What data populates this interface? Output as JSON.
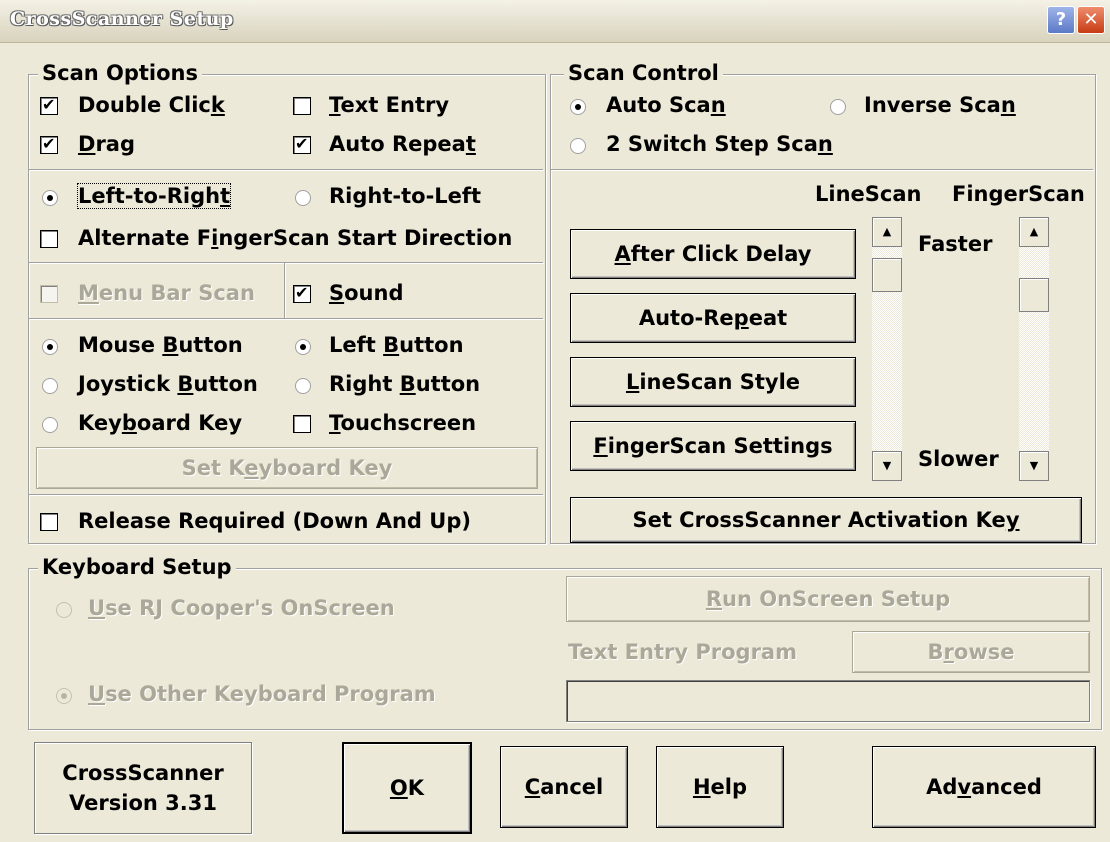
{
  "window": {
    "title": "CrossScanner Setup",
    "help_glyph": "?",
    "close_glyph": "✕"
  },
  "scan_options": {
    "title": "Scan Options",
    "double_click": {
      "pre": "Double Clic",
      "u": "k",
      "post": "",
      "checked": true
    },
    "text_entry": {
      "pre": "",
      "u": "T",
      "post": "ext Entry",
      "checked": false
    },
    "drag": {
      "pre": "",
      "u": "D",
      "post": "rag",
      "checked": true
    },
    "auto_repeat": {
      "pre": "Auto Repea",
      "u": "t",
      "post": "",
      "checked": true
    },
    "left_to_right": {
      "pre": "Left-to-Righ",
      "u": "t",
      "post": "",
      "selected": true
    },
    "right_to_left": {
      "label": "Right-to-Left",
      "selected": false
    },
    "alternate": {
      "pre": "Alternate F",
      "u": "i",
      "post": "ngerScan Start Direction",
      "checked": false
    },
    "menu_bar_scan": {
      "pre": "",
      "u": "M",
      "post": "enu Bar Scan",
      "checked": false,
      "enabled": false
    },
    "sound": {
      "pre": "",
      "u": "S",
      "post": "ound",
      "checked": true
    },
    "mouse_button": {
      "pre": "Mouse ",
      "u": "B",
      "post": "utton",
      "selected": true
    },
    "left_button": {
      "pre": "Left ",
      "u": "B",
      "post": "utton",
      "selected": true
    },
    "joystick_button": {
      "pre": "Joystick ",
      "u": "B",
      "post": "utton",
      "selected": false
    },
    "right_button": {
      "pre": "Right ",
      "u": "B",
      "post": "utton",
      "selected": false
    },
    "keyboard_key": {
      "pre": "Key",
      "u": "b",
      "post": "oard Key",
      "selected": false
    },
    "touchscreen": {
      "pre": "",
      "u": "T",
      "post": "ouchscreen",
      "checked": false
    },
    "set_keyboard_key": {
      "pre": "Set K",
      "u": "e",
      "post": "yboard Key"
    },
    "release_required": {
      "label": "Release Required (Down And Up)",
      "checked": false
    }
  },
  "scan_control": {
    "title": "Scan Control",
    "auto_scan": {
      "pre": "Auto Sca",
      "u": "n",
      "post": "",
      "selected": true
    },
    "inverse_scan": {
      "pre": "Inverse Sca",
      "u": "n",
      "post": "",
      "selected": false
    },
    "switch_step": {
      "pre": "2 Switch Step Sca",
      "u": "n",
      "post": "",
      "selected": false
    },
    "linescan_header": "LineScan",
    "fingerscan_header": "FingerScan",
    "faster": "Faster",
    "slower": "Slower",
    "after_click_delay": {
      "pre": "",
      "u": "A",
      "post": "fter Click Delay"
    },
    "auto_repeat_btn": {
      "pre": "Auto-Re",
      "u": "p",
      "post": "eat"
    },
    "linescan_style": {
      "pre": "",
      "u": "L",
      "post": "ineScan Style"
    },
    "fingerscan_settings": {
      "pre": "",
      "u": "F",
      "post": "ingerScan Settings"
    },
    "activation_key": {
      "pre": "Set CrossScanner Activation Ke",
      "u": "y",
      "post": ""
    }
  },
  "keyboard_setup": {
    "title": "Keyboard Setup",
    "use_rj": {
      "pre": "",
      "u": "U",
      "post": "se RJ Cooper's OnScreen",
      "selected": false
    },
    "use_other": {
      "pre": "",
      "u": "U",
      "post": "se Other Keyboard Program",
      "selected": true
    },
    "run_onscreen": {
      "pre": "",
      "u": "R",
      "post": "un OnScreen Setup"
    },
    "text_entry_program_label": "Text Entry Program",
    "browse": {
      "pre": "B",
      "u": "r",
      "post": "owse"
    },
    "program_path": ""
  },
  "footer": {
    "version_line1": "CrossScanner",
    "version_line2": "Version 3.31",
    "ok": {
      "pre": "",
      "u": "O",
      "post": "K"
    },
    "cancel": {
      "pre": "",
      "u": "C",
      "post": "ancel"
    },
    "help": {
      "pre": "",
      "u": "H",
      "post": "elp"
    },
    "advanced": {
      "pre": "Ad",
      "u": "v",
      "post": "anced"
    }
  },
  "colors": {
    "face": "#ece9d8",
    "shadow": "#a0a0a0",
    "disabled_text": "#aca899"
  }
}
